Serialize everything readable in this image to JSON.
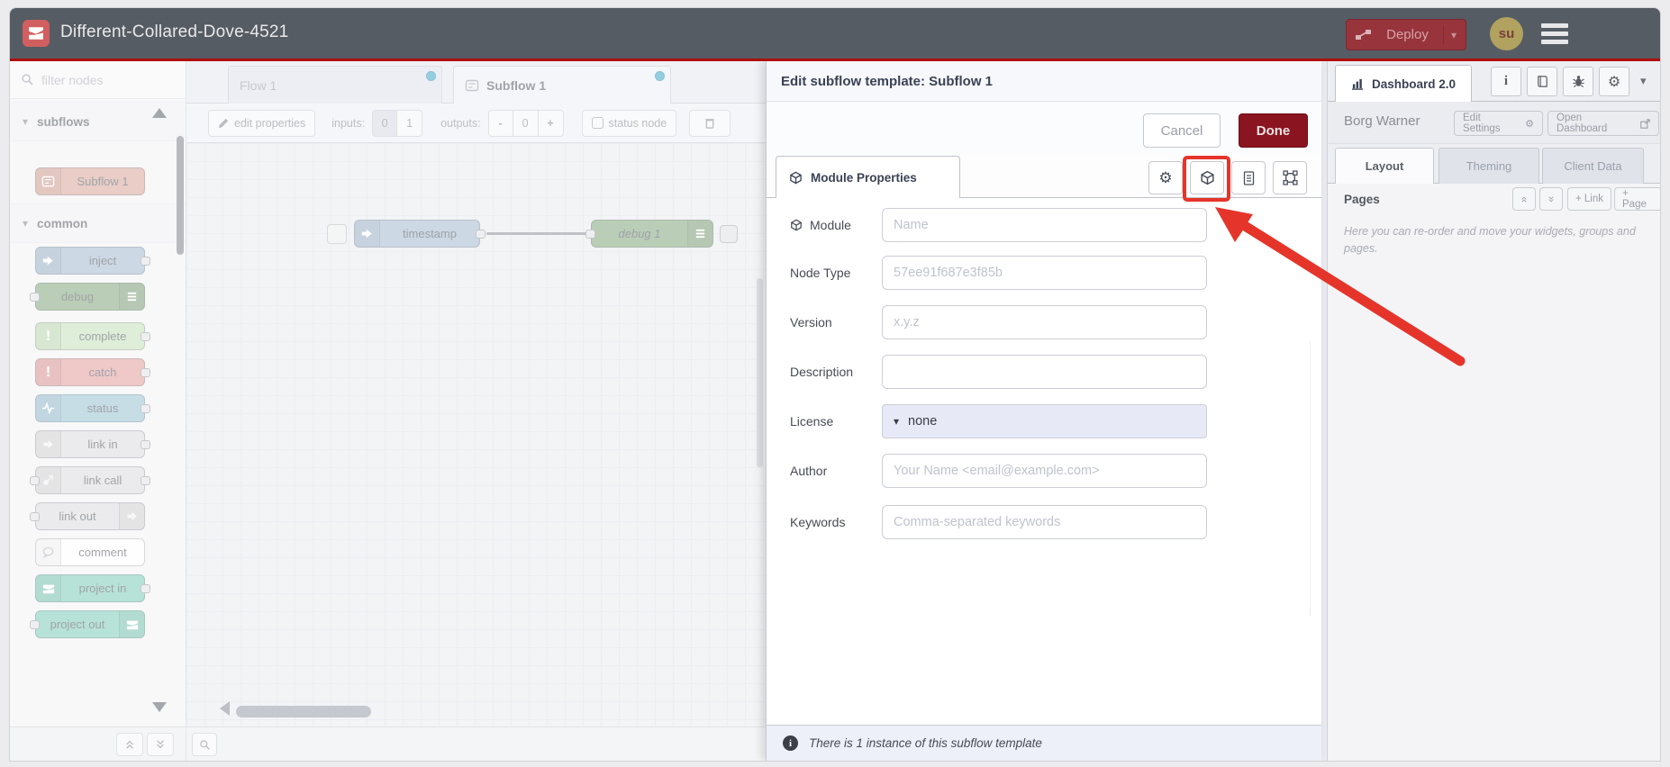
{
  "header": {
    "title": "Different-Collared-Dove-4521",
    "deploy_label": "Deploy",
    "avatar_text": "su"
  },
  "palette": {
    "filter_placeholder": "filter nodes",
    "sections": {
      "subflows": "subflows",
      "common": "common"
    },
    "subflow_nodes": [
      {
        "label": "Subflow 1",
        "color": "#d9a89b"
      }
    ],
    "common_nodes": [
      {
        "label": "inject",
        "color": "#a6bbcf"
      },
      {
        "label": "debug",
        "color": "#87a980"
      },
      {
        "label": "complete",
        "color": "#c5e2bc"
      },
      {
        "label": "catch",
        "color": "#e39e9e"
      },
      {
        "label": "status",
        "color": "#9cc3d4"
      },
      {
        "label": "link in",
        "color": "#dcdcdf"
      },
      {
        "label": "link call",
        "color": "#dcdcdf"
      },
      {
        "label": "link out",
        "color": "#dcdcdf"
      },
      {
        "label": "comment",
        "color": "#fdfdfd"
      },
      {
        "label": "project in",
        "color": "#7fcdb9"
      },
      {
        "label": "project out",
        "color": "#7fcdb9"
      }
    ]
  },
  "tabs": {
    "flow": "Flow 1",
    "subflow": "Subflow 1"
  },
  "toolbar": {
    "edit_properties": "edit properties",
    "inputs_label": "inputs:",
    "input_options": [
      "0",
      "1"
    ],
    "outputs_label": "outputs:",
    "output_controls": [
      "-",
      "0",
      "+"
    ],
    "status_node": "status node"
  },
  "canvas": {
    "nodes": [
      {
        "label": "timestamp"
      },
      {
        "label": "debug 1"
      }
    ]
  },
  "editor": {
    "title": "Edit subflow template: Subflow 1",
    "cancel": "Cancel",
    "done": "Done",
    "tab": "Module Properties",
    "fields": [
      {
        "label": "Module",
        "placeholder": "Name"
      },
      {
        "label": "Node Type",
        "placeholder": "57ee91f687e3f85b"
      },
      {
        "label": "Version",
        "placeholder": "x.y.z"
      },
      {
        "label": "Description",
        "placeholder": ""
      },
      {
        "label": "License",
        "value": "none"
      },
      {
        "label": "Author",
        "placeholder": "Your Name <email@example.com>"
      },
      {
        "label": "Keywords",
        "placeholder": "Comma-separated keywords"
      }
    ],
    "footer": "There is 1 instance of this subflow template"
  },
  "sidebar": {
    "tab": "Dashboard 2.0",
    "project": "Borg Warner",
    "edit_settings": "Edit Settings",
    "open_dashboard": "Open Dashboard",
    "tabs": [
      "Layout",
      "Theming",
      "Client Data"
    ],
    "pages_label": "Pages",
    "link_btn": "+ Link",
    "page_btn": "+ Page",
    "help": "Here you can re-order and move your widgets, groups and pages."
  },
  "colors": {
    "header_bg": "#565c63",
    "header_red_line": "#ad0e0e",
    "deploy_bg": "#97343c",
    "done_bg": "#8a1420",
    "highlight_red": "#e5352b",
    "tab_dot_blue": "#43aacb",
    "logo_red": "#d15f5f"
  }
}
